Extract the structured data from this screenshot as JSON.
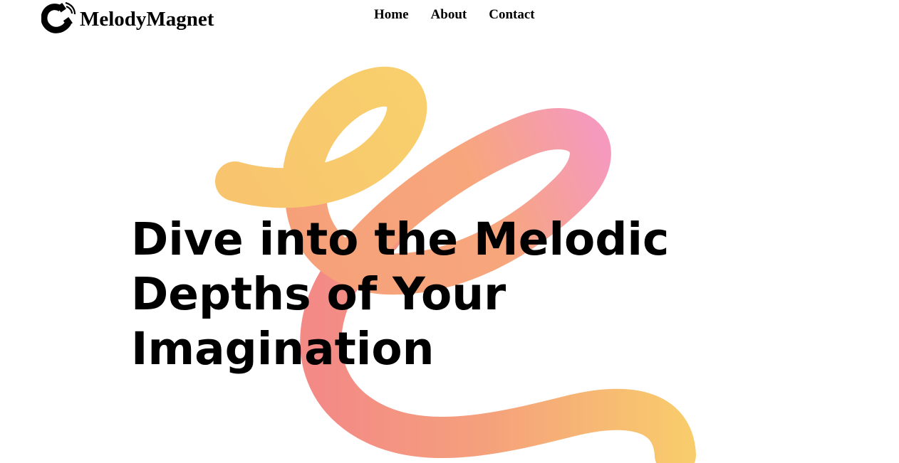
{
  "brand": {
    "name": "MelodyMagnet",
    "icon": "magnet-icon"
  },
  "nav": {
    "items": [
      {
        "label": "Home"
      },
      {
        "label": "About"
      },
      {
        "label": "Contact"
      }
    ]
  },
  "hero": {
    "title": "Dive into the Melodic Depths of Your Imagination"
  },
  "colors": {
    "text": "#000000",
    "background": "#ffffff",
    "swirl_yellow": "#f8cc6c",
    "swirl_orange": "#f6a478",
    "swirl_pink": "#f68c8c",
    "swirl_magenta": "#f49ac0"
  }
}
